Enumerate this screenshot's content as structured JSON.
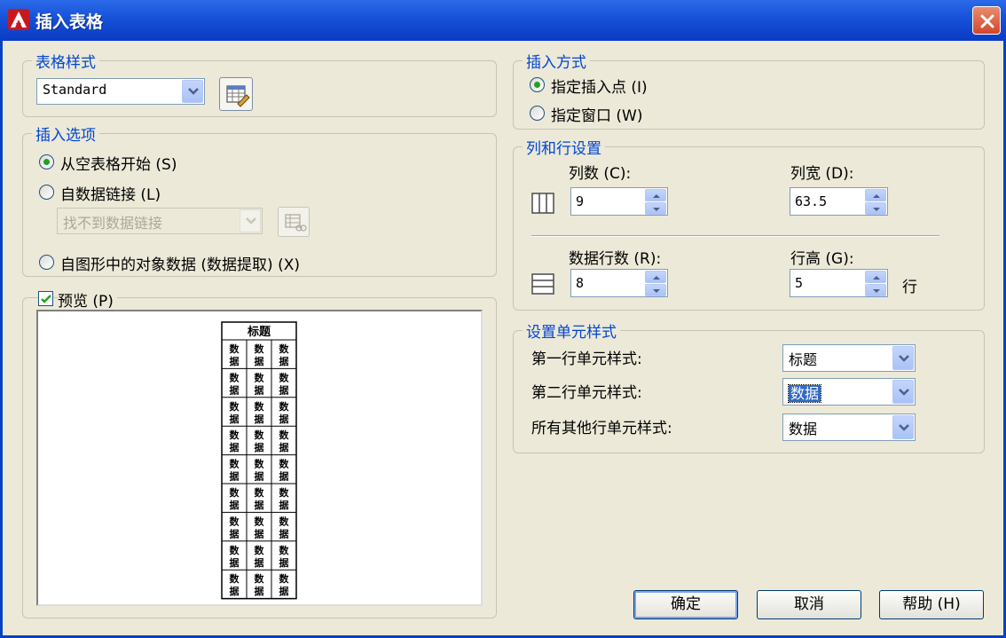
{
  "window": {
    "title": "插入表格"
  },
  "table_style": {
    "legend": "表格样式",
    "selected": "Standard"
  },
  "insert_options": {
    "legend": "插入选项",
    "opt_empty": "从空表格开始 (S)",
    "opt_datalink": "自数据链接 (L)",
    "datalink_combo": "找不到数据链接",
    "opt_object_data": "自图形中的对象数据 (数据提取) (X)"
  },
  "preview": {
    "label": "预览 (P)",
    "header": "标题",
    "cell": "数据",
    "rows": 9,
    "cols": 3
  },
  "insert_method": {
    "legend": "插入方式",
    "opt_point": "指定插入点 (I)",
    "opt_window": "指定窗口 (W)"
  },
  "col_row": {
    "legend": "列和行设置",
    "columns_label": "列数 (C):",
    "columns_value": "9",
    "col_width_label": "列宽 (D):",
    "col_width_value": "63.5",
    "data_rows_label": "数据行数 (R):",
    "data_rows_value": "8",
    "row_height_label": "行高 (G):",
    "row_height_value": "5",
    "row_unit": "行"
  },
  "cell_styles": {
    "legend": "设置单元样式",
    "first_row_label": "第一行单元样式:",
    "first_row_value": "标题",
    "second_row_label": "第二行单元样式:",
    "second_row_value": "数据",
    "other_rows_label": "所有其他行单元样式:",
    "other_rows_value": "数据"
  },
  "buttons": {
    "ok": "确定",
    "cancel": "取消",
    "help": "帮助 (H)"
  }
}
